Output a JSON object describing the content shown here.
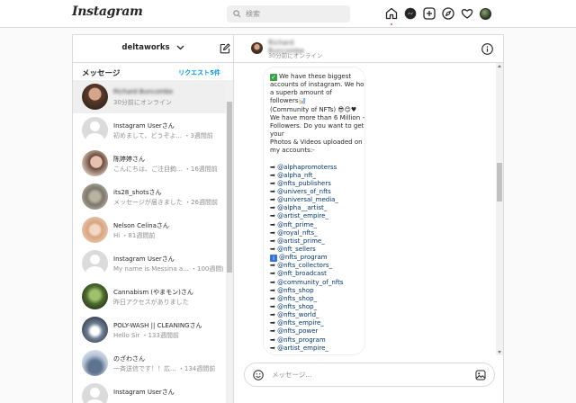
{
  "app": {
    "logo": "Instagram"
  },
  "search": {
    "placeholder": "検索"
  },
  "sidebar": {
    "account_name": "deltaworks",
    "messages_title": "メッセージ",
    "requests_label": "リクエスト5件",
    "threads": [
      {
        "name": "Richard Buncombe",
        "sub": "30分前にオンライン",
        "avatar": "av-man",
        "blurred_name": true
      },
      {
        "name": "Instagram Userさん",
        "sub": "初めまして、どうぞよ... ・3週間前",
        "avatar": "av-grey"
      },
      {
        "name": "陈婷婷さん",
        "sub": "こんにちは、ご注目鉤... ・16週間前",
        "avatar": "av-woman1"
      },
      {
        "name": "its28_shotsさん",
        "sub": "メッセージが届きました ・26週間前",
        "avatar": "av-shots"
      },
      {
        "name": "Nelson Celinaさん",
        "sub": "Hi ・81週間前",
        "avatar": "av-nelson"
      },
      {
        "name": "Instagram Userさん",
        "sub": "My name is Messina a... ・100週間前",
        "avatar": "av-grey"
      },
      {
        "name": "Cannabism (やまモン)さん",
        "sub": "昨日アクセスがありました",
        "avatar": "av-cannabis"
      },
      {
        "name": "POLY-WASH || CLEANINGさん",
        "sub": "Hello Sir ・133週間前",
        "avatar": "av-poly"
      },
      {
        "name": "のざわさん",
        "sub": "一斉送信です！！広... ・134週間前",
        "avatar": "av-nozawa"
      },
      {
        "name": "Instagram Userさん",
        "sub": "",
        "avatar": "av-grey"
      }
    ]
  },
  "chat": {
    "contact_name": "Richard Buncombe",
    "status": "30分前にオンライン",
    "message_lines": [
      {
        "t": "We have these biggest",
        "k": "check"
      },
      {
        "t": "accounts of instagram. We hold"
      },
      {
        "t": "a superb amount of"
      },
      {
        "t": "followers📊"
      },
      {
        "t": "(Community of NFTs) 😎😊♥"
      },
      {
        "t": "We have more than 6 Million +"
      },
      {
        "t": "Followers. Do you want to get"
      },
      {
        "t": "your"
      },
      {
        "t": "Photos & Videos uploaded on"
      },
      {
        "t": "my accounts:-"
      },
      {
        "t": "",
        "k": "gap"
      },
      {
        "t": "@alphapromoterss",
        "k": "link"
      },
      {
        "t": "@alpha_nft_",
        "k": "link"
      },
      {
        "t": "@nfts_publishers",
        "k": "link"
      },
      {
        "t": "@univers_of_nfts",
        "k": "link"
      },
      {
        "t": "@universal_media_",
        "k": "link"
      },
      {
        "t": "@alpha__artist_",
        "k": "link"
      },
      {
        "t": "@artist_empire_",
        "k": "link"
      },
      {
        "t": "@nft_prime_",
        "k": "link"
      },
      {
        "t": "@royal_nfts_",
        "k": "link"
      },
      {
        "t": "@artist_prime_",
        "k": "link"
      },
      {
        "t": "@nft_sellers",
        "k": "link"
      },
      {
        "t": "@nfts_program",
        "k": "info"
      },
      {
        "t": "@nfts_collectors_",
        "k": "link"
      },
      {
        "t": "@nft_broadcast",
        "k": "link"
      },
      {
        "t": "@community_of_nfts",
        "k": "link"
      },
      {
        "t": "@nfts_shop",
        "k": "link"
      },
      {
        "t": "@nfts_shop_",
        "k": "link"
      },
      {
        "t": "@nfts_shop_",
        "k": "link"
      },
      {
        "t": "@nfts_world_",
        "k": "link"
      },
      {
        "t": "@nfts_empire_",
        "k": "link"
      },
      {
        "t": "@nfts_power",
        "k": "link"
      },
      {
        "t": "@nfts_program",
        "k": "link"
      },
      {
        "t": "@artist_empire_",
        "k": "link"
      }
    ],
    "composer_placeholder": "メッセージ..."
  },
  "icons": {
    "arrow": "➡",
    "check": "✓",
    "info": "i"
  }
}
